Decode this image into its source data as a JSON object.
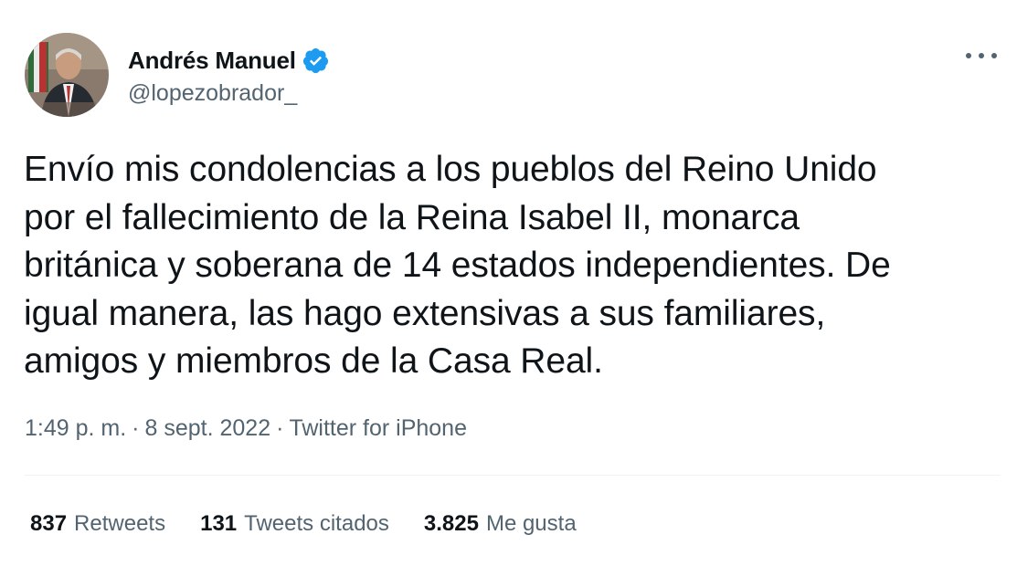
{
  "user": {
    "display_name": "Andrés Manuel",
    "handle": "@lopezobrador_",
    "verified": true,
    "verified_color": "#1d9bf0"
  },
  "tweet": {
    "text": "Envío mis condolencias a los pueblos del Reino Unido\npor el fallecimiento de la Reina Isabel II, monarca\nbritánica y soberana de 14 estados independientes. De\nigual manera, las hago extensivas a sus familiares,\namigos y miembros de la Casa Real.",
    "time": "1:49 p. m.",
    "date": "8 sept. 2022",
    "separator": "·",
    "source": "Twitter for iPhone"
  },
  "stats": {
    "retweets_count": "837",
    "retweets_label": "Retweets",
    "quotes_count": "131",
    "quotes_label": "Tweets citados",
    "likes_count": "3.825",
    "likes_label": "Me gusta"
  },
  "icons": {
    "more": "more-horizontal-icon",
    "verified": "verified-badge-icon"
  },
  "colors": {
    "text_primary": "#0f1419",
    "text_secondary": "#536471",
    "divider": "#eff3f4",
    "accent": "#1d9bf0"
  }
}
